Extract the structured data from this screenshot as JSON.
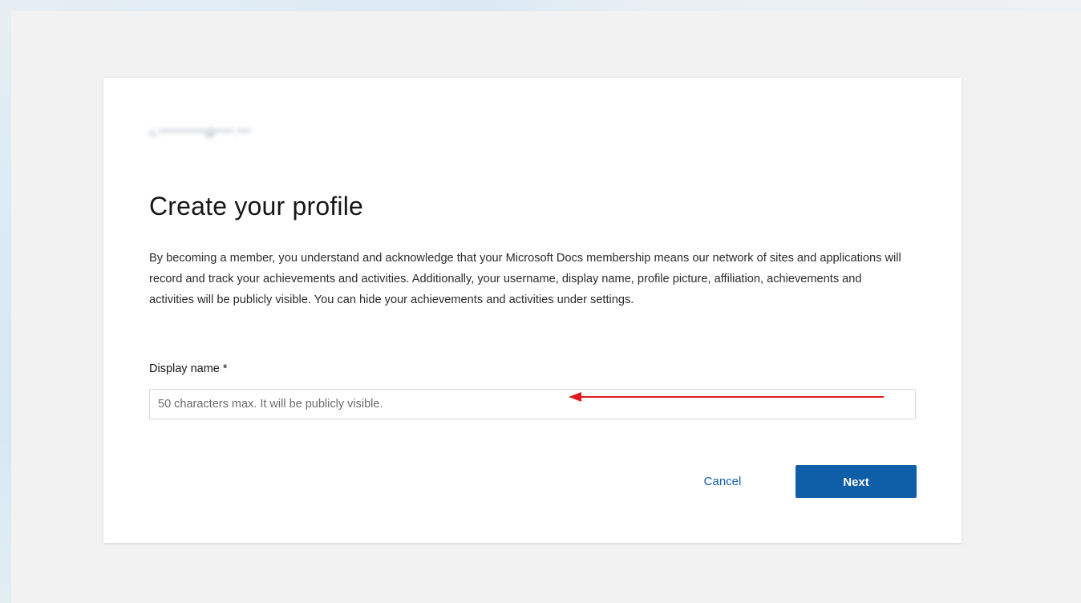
{
  "account": {
    "email": "c.**********@****.***"
  },
  "form": {
    "title": "Create your profile",
    "description": "By becoming a member, you understand and acknowledge that your Microsoft Docs membership means our network of sites and applications will record and track your achievements and activities. Additionally, your username, display name, profile picture, affiliation, achievements and activities will be publicly visible. You can hide your achievements and activities under settings.",
    "display_name": {
      "label": "Display name *",
      "value": "",
      "placeholder": "50 characters max. It will be publicly visible."
    },
    "cancel_label": "Cancel",
    "next_label": "Next"
  },
  "annotation": {
    "arrow_color": "#e0191e",
    "icon": "arrow-left-icon"
  },
  "colors": {
    "primary": "#0f5fa8",
    "background": "#f2f2f2",
    "card": "#ffffff"
  }
}
